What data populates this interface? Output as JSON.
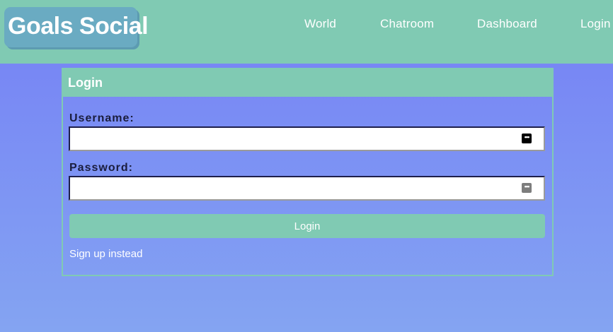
{
  "header": {
    "brand": "Goals Social",
    "nav": [
      {
        "label": "World"
      },
      {
        "label": "Chatroom"
      },
      {
        "label": "Dashboard"
      },
      {
        "label": "Login"
      }
    ]
  },
  "login_card": {
    "title": "Login",
    "username": {
      "label": "Username:",
      "value": "",
      "icon": "password-manager-key-icon"
    },
    "password": {
      "label": "Password:",
      "value": "",
      "icon": "password-manager-key-icon"
    },
    "submit_label": "Login",
    "signup_link": "Sign up instead"
  },
  "colors": {
    "accent": "#80cab3",
    "brand_badge": "#6aabc2",
    "background_top": "#7580f5",
    "background_bottom": "#84a4f2",
    "label_text": "#1a1d3d"
  }
}
